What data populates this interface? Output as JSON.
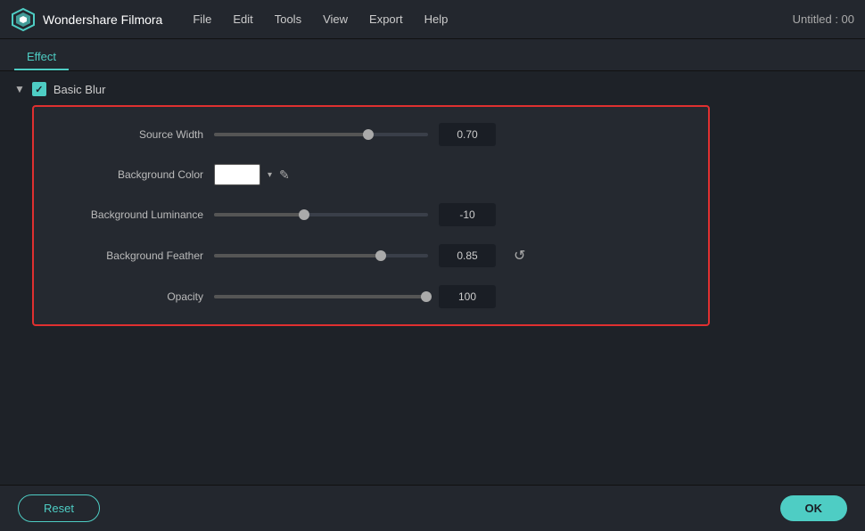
{
  "titleBar": {
    "appName": "Wondershare Filmora",
    "windowTitle": "Untitled : 00",
    "menuItems": [
      "File",
      "Edit",
      "Tools",
      "View",
      "Export",
      "Help"
    ]
  },
  "tabs": {
    "active": "Effect",
    "items": [
      "Effect"
    ]
  },
  "section": {
    "name": "Basic Blur",
    "params": [
      {
        "label": "Source Width",
        "type": "slider",
        "value": "0.70",
        "fillPercent": 72
      },
      {
        "label": "Background Color",
        "type": "color",
        "color": "#ffffff"
      },
      {
        "label": "Background Luminance",
        "type": "slider",
        "value": "-10",
        "fillPercent": 42
      },
      {
        "label": "Background Feather",
        "type": "slider",
        "value": "0.85",
        "fillPercent": 78,
        "hasReset": true
      },
      {
        "label": "Opacity",
        "type": "slider",
        "value": "100",
        "fillPercent": 99
      }
    ]
  },
  "bottomBar": {
    "resetLabel": "Reset",
    "okLabel": "OK"
  },
  "icons": {
    "logo": "diamond",
    "chevron": "▼",
    "checkbox": "✓",
    "dropdownArrow": "▾",
    "eyedropper": "✎",
    "reset": "↺"
  }
}
